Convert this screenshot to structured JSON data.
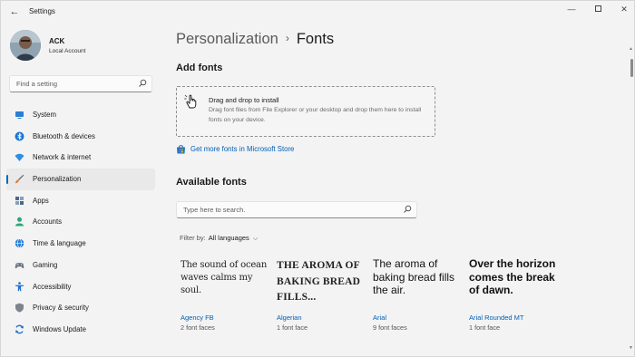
{
  "window": {
    "title": "Settings",
    "back": "←",
    "minimize": "—",
    "close": "✕"
  },
  "profile": {
    "name": "ACK",
    "subtitle": "Local Account"
  },
  "sidebar_search": {
    "placeholder": "Find a setting"
  },
  "nav": {
    "items": [
      {
        "label": "System",
        "icon": "system-icon",
        "color": "#2a7fd4"
      },
      {
        "label": "Bluetooth & devices",
        "icon": "bluetooth-icon",
        "color": "#1b76d2"
      },
      {
        "label": "Network & internet",
        "icon": "wifi-icon",
        "color": "#2f8ee0"
      },
      {
        "label": "Personalization",
        "icon": "brush-icon",
        "color": "#e07b32",
        "selected": true
      },
      {
        "label": "Apps",
        "icon": "apps-icon",
        "color": "#4a6a8a"
      },
      {
        "label": "Accounts",
        "icon": "person-icon",
        "color": "#2aa875"
      },
      {
        "label": "Time & language",
        "icon": "globe-icon",
        "color": "#2a7fd4"
      },
      {
        "label": "Gaming",
        "icon": "gamepad-icon",
        "color": "#6a7480"
      },
      {
        "label": "Accessibility",
        "icon": "accessibility-icon",
        "color": "#1f6fcf"
      },
      {
        "label": "Privacy & security",
        "icon": "shield-icon",
        "color": "#7d848c"
      },
      {
        "label": "Windows Update",
        "icon": "sync-icon",
        "color": "#1f6fcf"
      }
    ]
  },
  "breadcrumb": {
    "parent": "Personalization",
    "separator": "›",
    "current": "Fonts"
  },
  "add_fonts": {
    "heading": "Add fonts",
    "drop_title": "Drag and drop to install",
    "drop_desc": "Drag font files from File Explorer or your desktop and drop them here to install fonts on your device.",
    "store_link": "Get more fonts in Microsoft Store"
  },
  "available_fonts": {
    "heading": "Available fonts",
    "search_placeholder": "Type here to search.",
    "filter_label": "Filter by:",
    "filter_value": "All languages",
    "cards": [
      {
        "preview": "The sound of ocean waves calms my soul.",
        "name": "Agency FB",
        "faces": "2 font faces"
      },
      {
        "preview": "THE AROMA OF BAKING BREAD FILLS...",
        "name": "Algerian",
        "faces": "1 font face"
      },
      {
        "preview": "The aroma of baking bread fills the air.",
        "name": "Arial",
        "faces": "9 font faces"
      },
      {
        "preview": "Over the horizon comes the break of dawn.",
        "name": "Arial Rounded MT",
        "faces": "1 font face"
      }
    ]
  },
  "accent_color": "#005fb8"
}
